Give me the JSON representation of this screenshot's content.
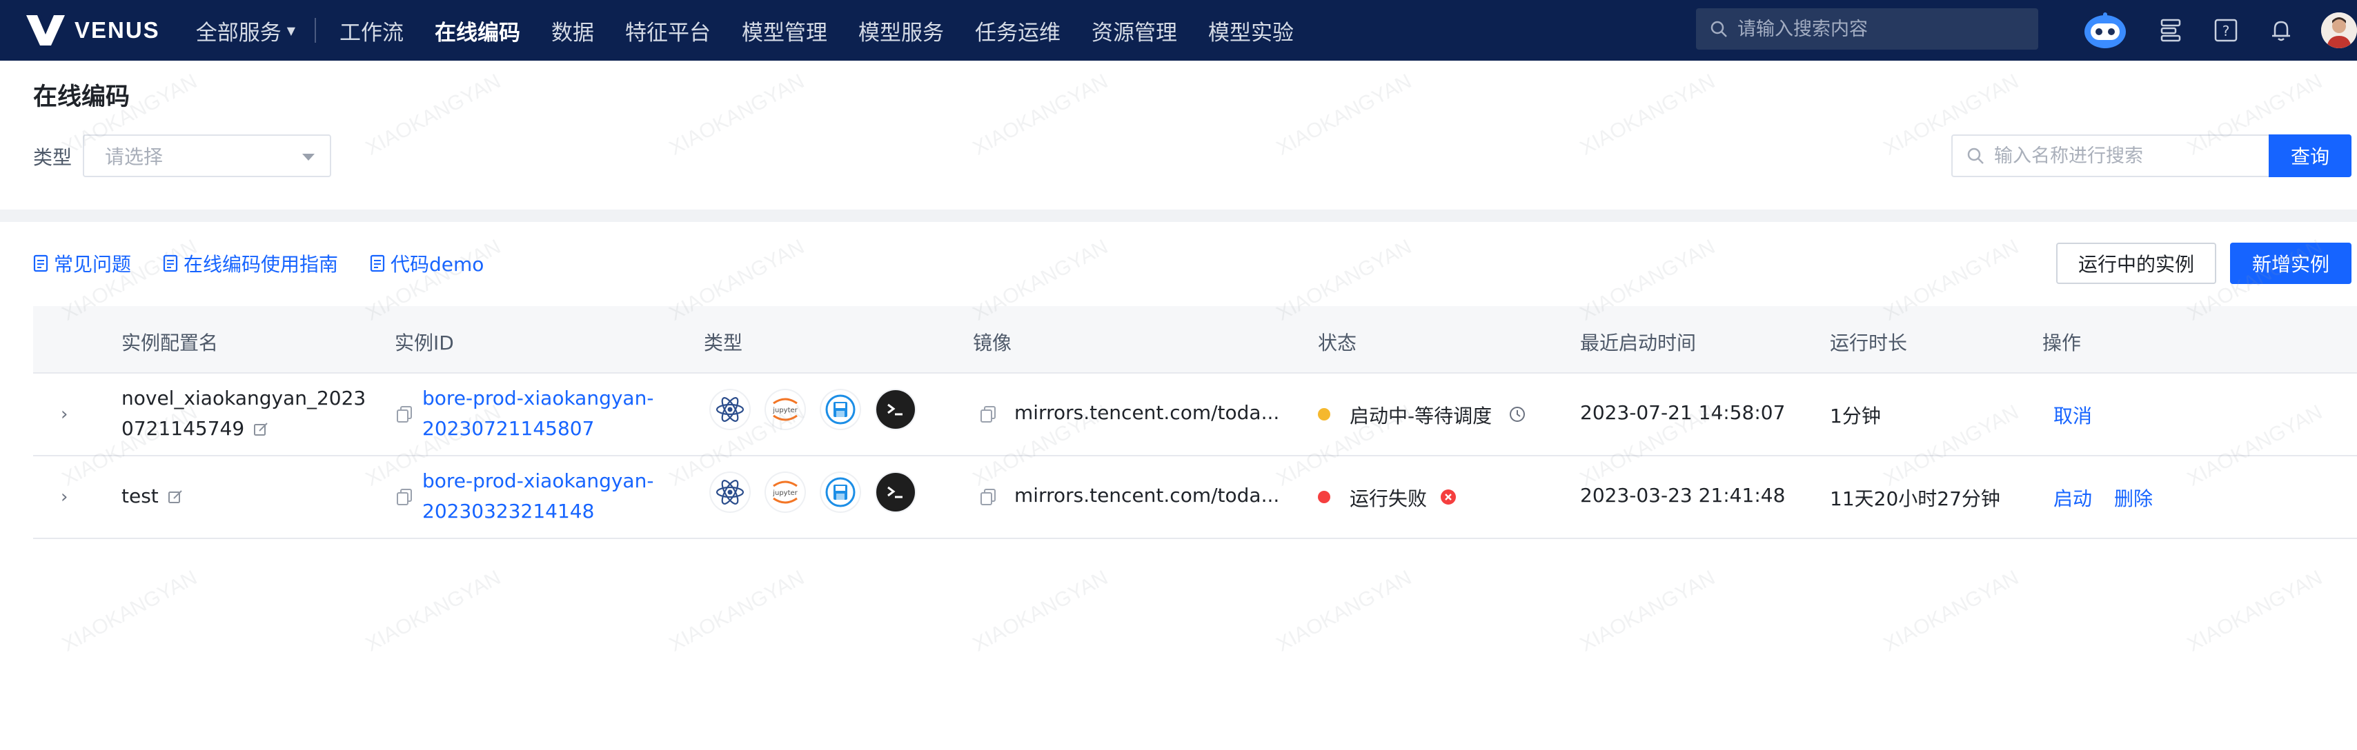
{
  "brand": {
    "name": "VENUS"
  },
  "nav": {
    "all_services": "全部服务",
    "items": [
      "工作流",
      "在线编码",
      "数据",
      "特征平台",
      "模型管理",
      "模型服务",
      "任务运维",
      "资源管理",
      "模型实验"
    ],
    "active": "在线编码"
  },
  "top_search": {
    "placeholder": "请输入搜索内容"
  },
  "page": {
    "title": "在线编码"
  },
  "filter": {
    "type_label": "类型",
    "type_placeholder": "请选择",
    "search_placeholder": "输入名称进行搜索",
    "query_button": "查询"
  },
  "toolbar": {
    "links": [
      "常见问题",
      "在线编码使用指南",
      "代码demo"
    ],
    "running_button": "运行中的实例",
    "add_button": "新增实例"
  },
  "table": {
    "headers": [
      "实例配置名",
      "实例ID",
      "类型",
      "镜像",
      "状态",
      "最近启动时间",
      "运行时长",
      "操作"
    ],
    "rows": [
      {
        "name_line1": "novel_xiaokangyan_2023",
        "name_line2": "0721145749",
        "id_line1": "bore-prod-xiaokangyan-",
        "id_line2": "20230721145807",
        "mirror": "mirrors.tencent.com/toda...",
        "status": "启动中-等待调度",
        "status_color": "#f5b82e",
        "start_time": "2023-07-21 14:58:07",
        "duration": "1分钟",
        "actions": [
          "取消"
        ]
      },
      {
        "name_line1": "test",
        "name_line2": "",
        "id_line1": "bore-prod-xiaokangyan-",
        "id_line2": "20230323214148",
        "mirror": "mirrors.tencent.com/toda...",
        "status": "运行失败",
        "status_color": "#f53f3f",
        "start_time": "2023-03-23 21:41:48",
        "duration": "11天20小时27分钟",
        "actions": [
          "启动",
          "删除"
        ]
      }
    ]
  },
  "type_icons": [
    "atom-icon",
    "jupyterlab-icon",
    "vscode-save-icon",
    "terminal-icon"
  ],
  "type_icon_text": {
    "jupyter": "jupyter"
  },
  "watermark": "XIAOKANGYAN",
  "colors": {
    "nav_bg": "#0c2150",
    "primary": "#1664ff"
  }
}
